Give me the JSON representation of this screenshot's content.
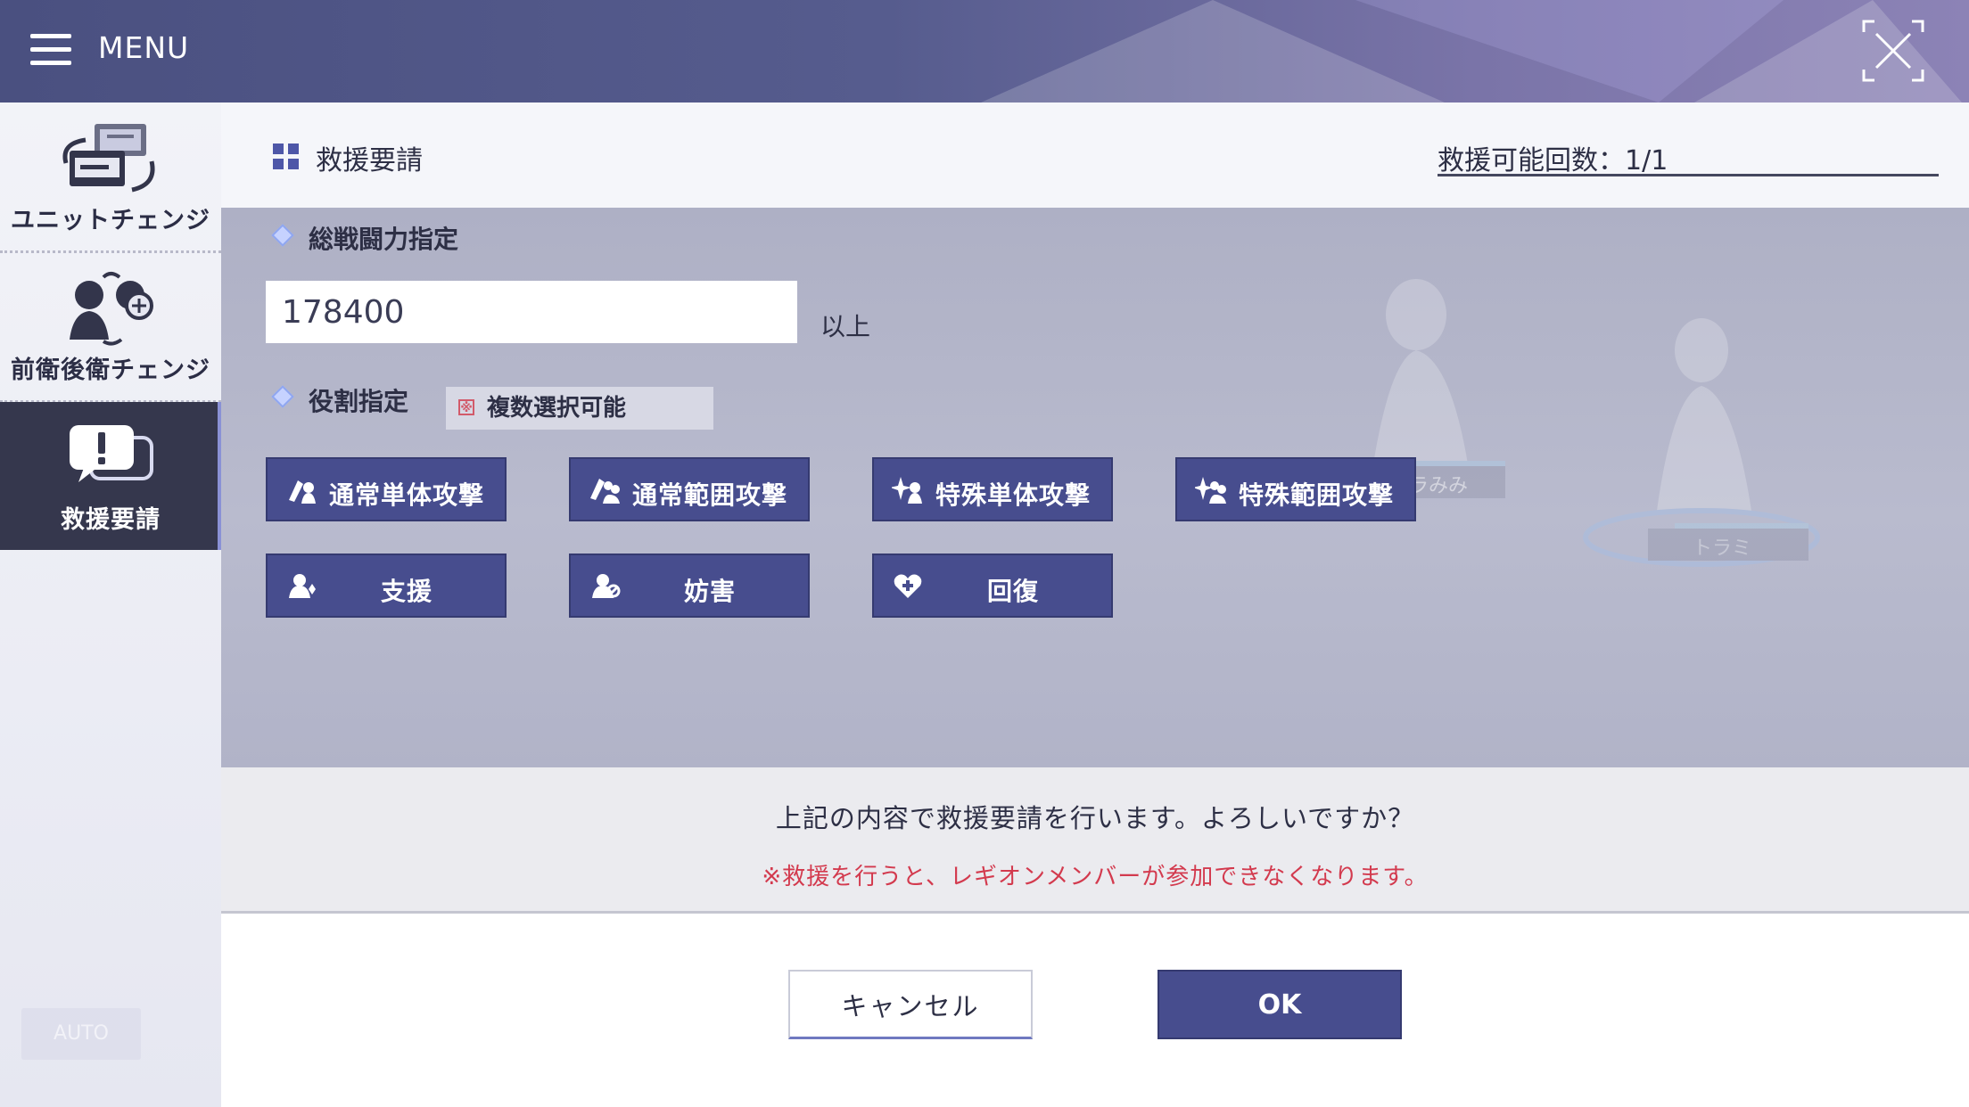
{
  "topbar": {
    "menu_label": "MENU"
  },
  "sidebar": {
    "items": [
      {
        "label": "ユニットチェンジ",
        "icon": "unit-change-icon"
      },
      {
        "label": "前衛後衛チェンジ",
        "icon": "position-change-icon"
      },
      {
        "label": "救援要請",
        "icon": "rescue-request-icon",
        "active": true
      }
    ],
    "faded_button_label": "AUTO"
  },
  "panel": {
    "title": "救援要請",
    "rescue_count": "救援可能回数：1/1",
    "power": {
      "label": "総戦闘力指定",
      "value": "178400",
      "suffix": "以上"
    },
    "role": {
      "label": "役割指定",
      "multi_badge_mark": "※",
      "multi_badge_text": "複数選択可能",
      "buttons": [
        {
          "label": "通常単体攻撃",
          "icon": "normal-single-attack-icon"
        },
        {
          "label": "通常範囲攻撃",
          "icon": "normal-area-attack-icon"
        },
        {
          "label": "特殊単体攻撃",
          "icon": "special-single-attack-icon"
        },
        {
          "label": "特殊範囲攻撃",
          "icon": "special-area-attack-icon"
        },
        {
          "label": "支援",
          "icon": "support-icon"
        },
        {
          "label": "妨害",
          "icon": "obstruct-icon"
        },
        {
          "label": "回復",
          "icon": "heal-icon"
        }
      ]
    },
    "background_labels": [
      "ドラみみ",
      "トラミ"
    ]
  },
  "confirm": {
    "message": "上記の内容で救援要請を行います。よろしいですか？",
    "warning": "※救援を行うと、レギオンメンバーが参加できなくなります。"
  },
  "footer": {
    "cancel_label": "キャンセル",
    "ok_label": "OK"
  },
  "colors": {
    "accent": "#474d8e",
    "warning": "#d33a4e",
    "sidebar_active": "#35374d"
  }
}
